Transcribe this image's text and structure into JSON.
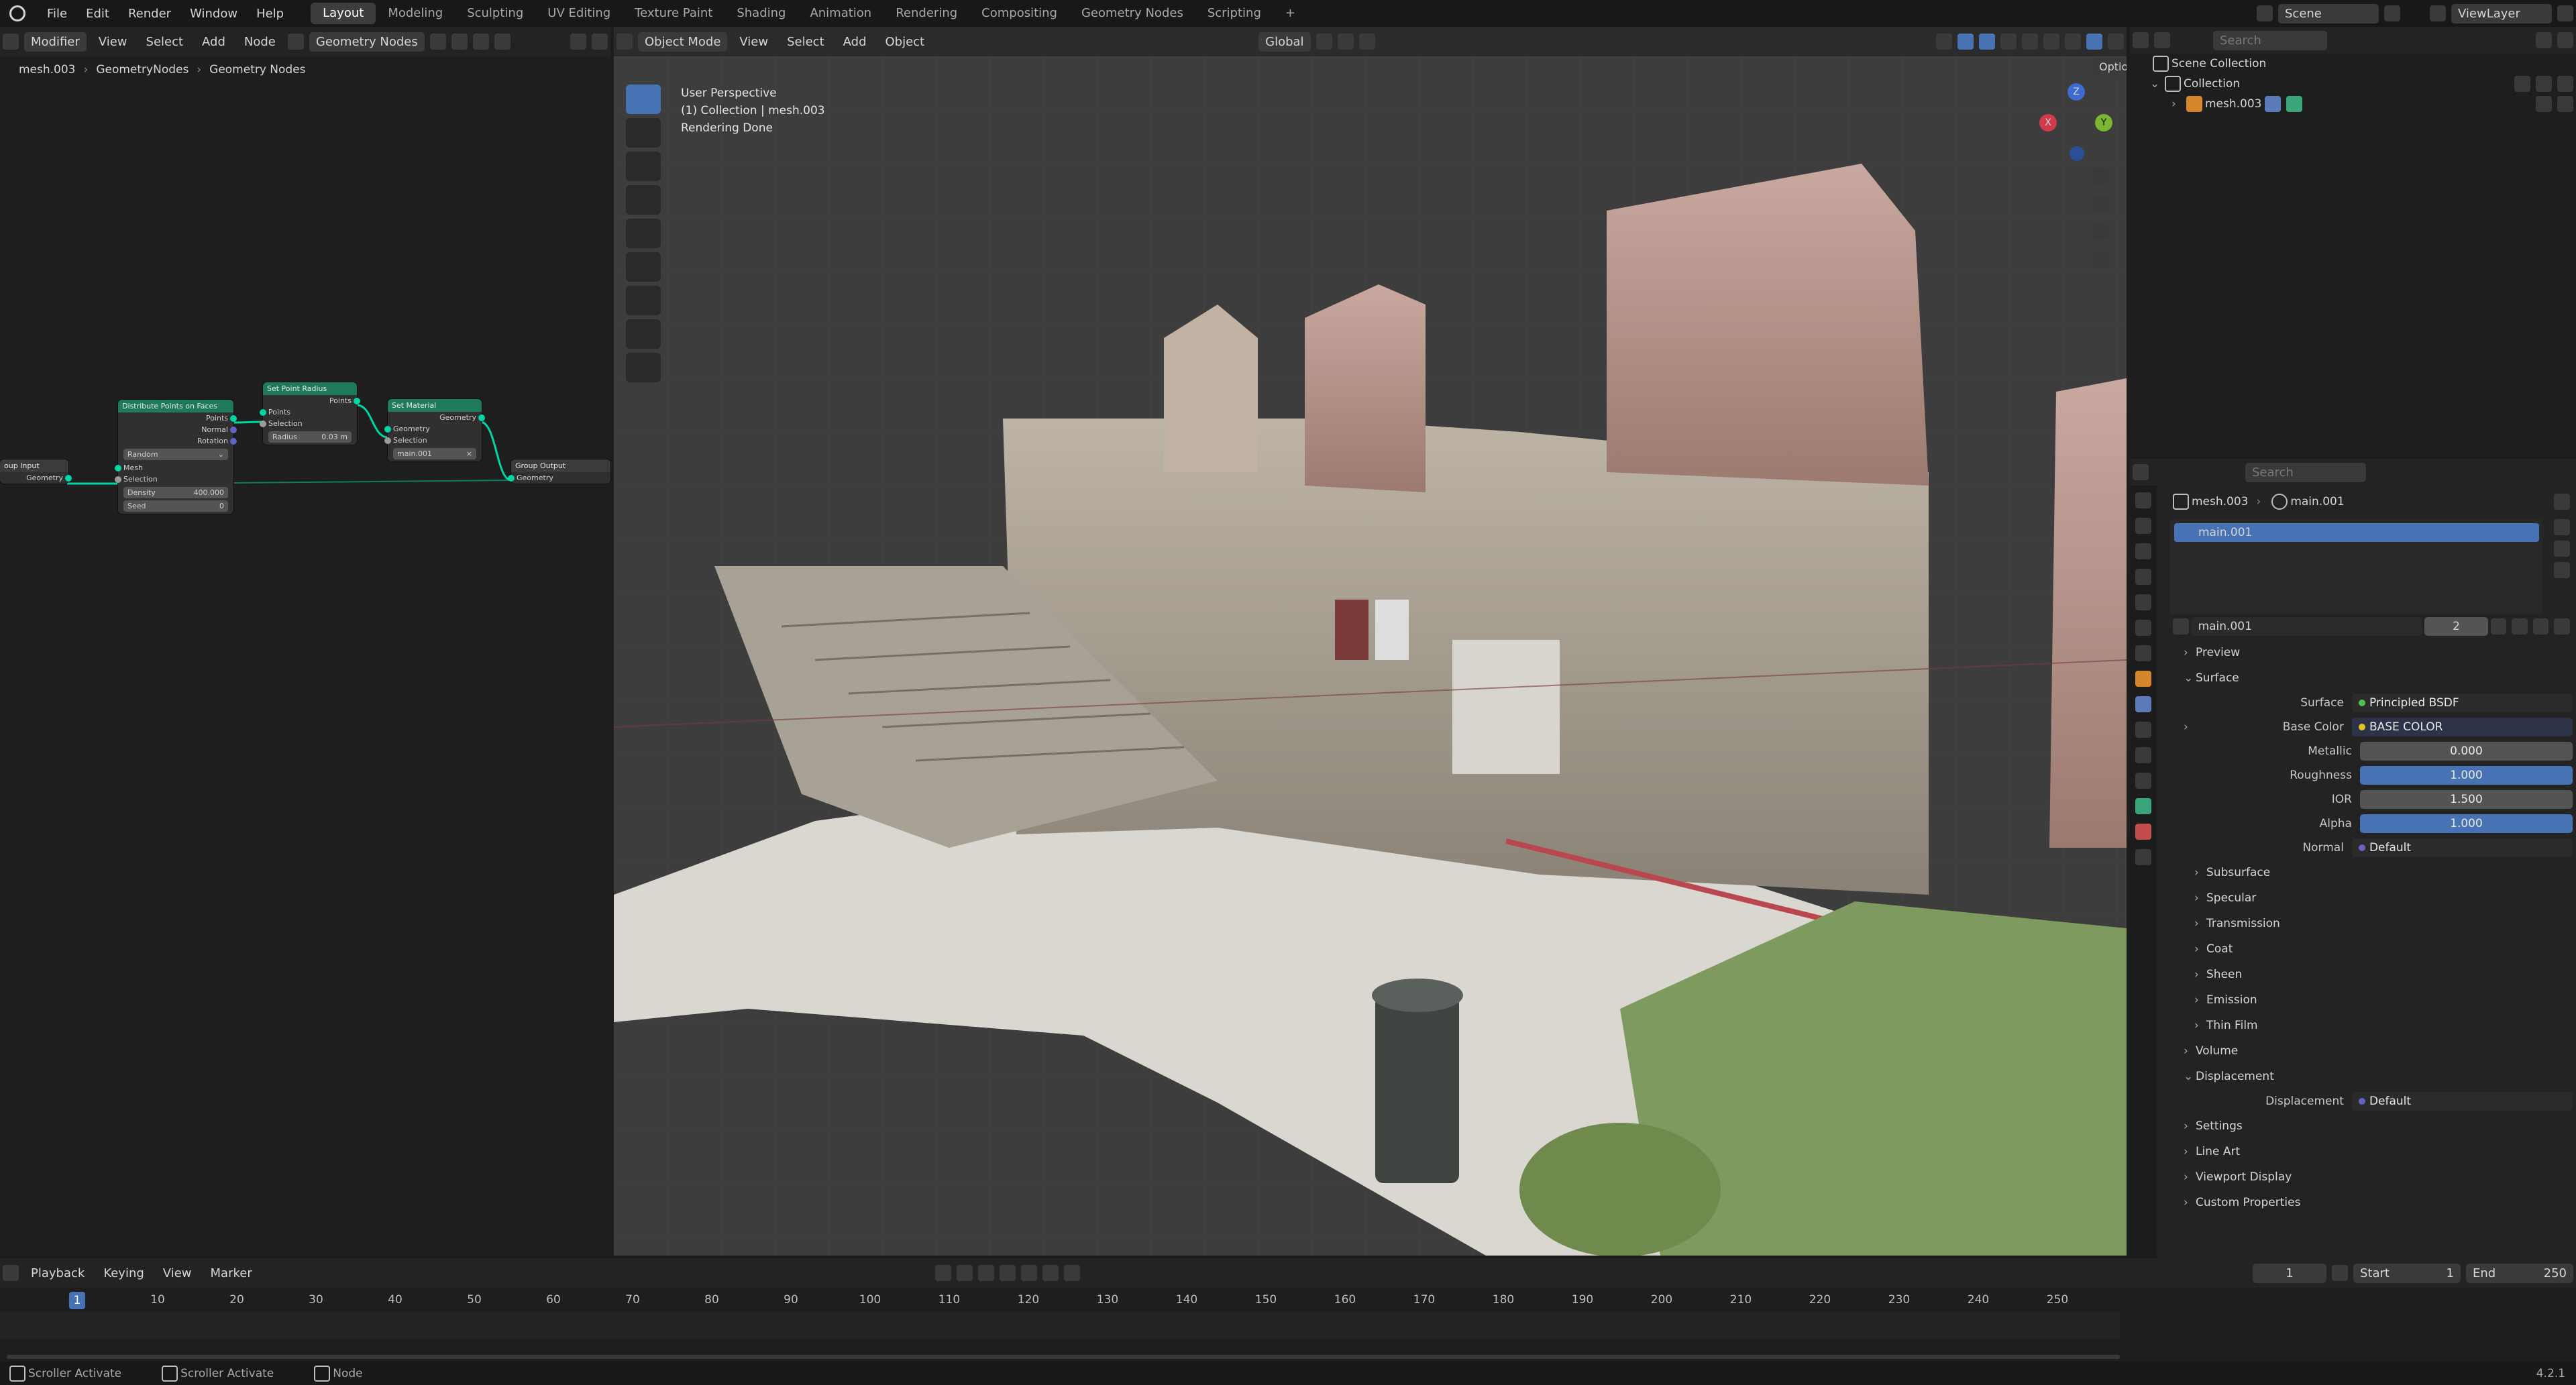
{
  "topbar": {
    "menus": [
      "File",
      "Edit",
      "Render",
      "Window",
      "Help"
    ],
    "workspaces": [
      "Layout",
      "Modeling",
      "Sculpting",
      "UV Editing",
      "Texture Paint",
      "Shading",
      "Animation",
      "Rendering",
      "Compositing",
      "Geometry Nodes",
      "Scripting"
    ],
    "active_workspace": "Layout",
    "scene": "Scene",
    "view_layer": "ViewLayer"
  },
  "node_editor": {
    "header": {
      "mode": "Modifier",
      "menus": [
        "View",
        "Select",
        "Add",
        "Node"
      ],
      "tree_name": "Geometry Nodes"
    },
    "breadcrumb": [
      "mesh.003",
      "GeometryNodes",
      "Geometry Nodes"
    ],
    "nodes": {
      "group_input": {
        "title": "oup Input",
        "out": "Geometry"
      },
      "distribute": {
        "title": "Distribute Points on Faces",
        "outs": [
          "Points",
          "Normal",
          "Rotation"
        ],
        "mode": "Random",
        "ins": [
          "Mesh",
          "Selection"
        ],
        "density_label": "Density",
        "density": "400.000",
        "seed_label": "Seed",
        "seed": "0"
      },
      "set_radius": {
        "title": "Set Point Radius",
        "out": "Points",
        "ins": [
          "Points",
          "Selection"
        ],
        "radius_label": "Radius",
        "radius": "0.03 m"
      },
      "set_material": {
        "title": "Set Material",
        "out": "Geometry",
        "ins": [
          "Geometry",
          "Selection"
        ],
        "material": "main.001"
      },
      "group_output": {
        "title": "Group Output",
        "in": "Geometry"
      }
    }
  },
  "viewport": {
    "header": {
      "mode": "Object Mode",
      "menus": [
        "View",
        "Select",
        "Add",
        "Object"
      ],
      "transform": "Global",
      "options": "Options"
    },
    "info": [
      "User Perspective",
      "(1) Collection | mesh.003",
      "Rendering Done"
    ],
    "gizmo": {
      "x": "X",
      "y": "Y",
      "z": "Z"
    }
  },
  "outliner": {
    "search_placeholder": "Search",
    "scene_collection": "Scene Collection",
    "collection": "Collection",
    "object": "mesh.003"
  },
  "properties": {
    "search_placeholder": "Search",
    "breadcrumb": [
      "mesh.003",
      "main.001"
    ],
    "slot": "main.001",
    "material_name": "main.001",
    "users": "2",
    "panels": {
      "preview": "Preview",
      "surface": "Surface",
      "subsurface": "Subsurface",
      "specular": "Specular",
      "transmission": "Transmission",
      "coat": "Coat",
      "sheen": "Sheen",
      "emission": "Emission",
      "thin_film": "Thin Film",
      "volume": "Volume",
      "displacement": "Displacement",
      "settings": "Settings",
      "line_art": "Line Art",
      "viewport_display": "Viewport Display",
      "custom_properties": "Custom Properties"
    },
    "surface_fields": [
      {
        "label": "Surface",
        "value": "Principled BSDF",
        "style": "dark"
      },
      {
        "label": "Base Color",
        "value": "BASE COLOR",
        "style": "dark"
      },
      {
        "label": "Metallic",
        "value": "0.000",
        "style": "gray"
      },
      {
        "label": "Roughness",
        "value": "1.000",
        "style": "blue"
      },
      {
        "label": "IOR",
        "value": "1.500",
        "style": "gray"
      },
      {
        "label": "Alpha",
        "value": "1.000",
        "style": "blue"
      },
      {
        "label": "Normal",
        "value": "Default",
        "style": "dark"
      }
    ],
    "displacement_field": {
      "label": "Displacement",
      "value": "Default"
    }
  },
  "timeline": {
    "menus": [
      "Playback",
      "Keying",
      "View",
      "Marker"
    ],
    "current_frame": "1",
    "start_label": "Start",
    "start": "1",
    "end_label": "End",
    "end": "250",
    "ticks": [
      "10",
      "20",
      "30",
      "40",
      "50",
      "60",
      "70",
      "80",
      "90",
      "100",
      "110",
      "120",
      "130",
      "140",
      "150",
      "160",
      "170",
      "180",
      "190",
      "200",
      "210",
      "220",
      "230",
      "240",
      "250"
    ],
    "playhead": "1"
  },
  "statusbar": {
    "items": [
      "Scroller Activate",
      "Scroller Activate",
      "Node"
    ],
    "version": "4.2.1"
  },
  "colors": {
    "accent": "#4772b3",
    "node_header": "#1f7a5c",
    "socket_geometry": "#00d6a3"
  }
}
